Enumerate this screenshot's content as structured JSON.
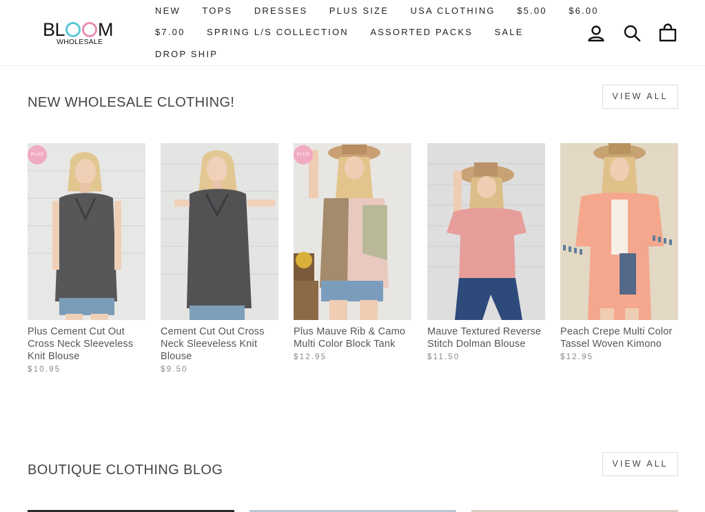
{
  "header": {
    "logo_main": "BLOOM",
    "logo_sub": "WHOLESALE",
    "nav_row1": [
      "NEW",
      "TOPS",
      "DRESSES",
      "PLUS SIZE",
      "USA CLOTHING",
      "$5.00",
      "$6.00"
    ],
    "nav_row2": [
      "$7.00",
      "SPRING L/S COLLECTION",
      "ASSORTED PACKS",
      "SALE"
    ],
    "nav_row3": [
      "DROP SHIP"
    ],
    "icons": [
      "account-icon",
      "search-icon",
      "cart-icon"
    ]
  },
  "new_section": {
    "title": "NEW WHOLESALE CLOTHING!",
    "view_all": "VIEW ALL"
  },
  "products": [
    {
      "title": "Plus Cement Cut Out Cross Neck Sleeveless Knit Blouse",
      "price": "$10.95",
      "badge": "PLUS"
    },
    {
      "title": "Cement Cut Out Cross Neck Sleeveless Knit Blouse",
      "price": "$9.50",
      "badge": ""
    },
    {
      "title": "Plus Mauve Rib & Camo Multi Color Block Tank",
      "price": "$12.95",
      "badge": "PLUS"
    },
    {
      "title": "Mauve Textured Reverse Stitch Dolman Blouse",
      "price": "$11.50",
      "badge": ""
    },
    {
      "title": "Peach Crepe Multi Color Tassel Woven Kimono",
      "price": "$12.95",
      "badge": ""
    }
  ],
  "blog_section": {
    "title": "BOUTIQUE CLOTHING BLOG",
    "view_all": "VIEW ALL"
  },
  "colors": {
    "accent_cyan": "#5bc7d8",
    "accent_pink": "#e88fb6",
    "badge_pink": "#f1a4bf"
  }
}
